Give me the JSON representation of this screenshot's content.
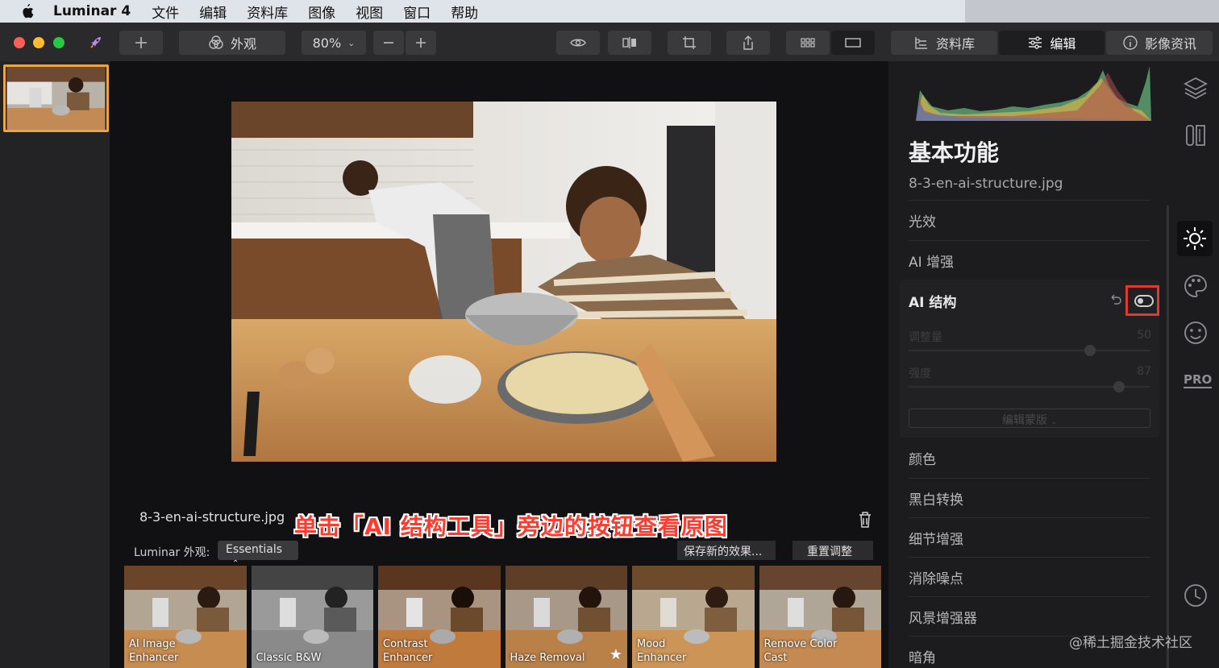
{
  "menubar": {
    "app_name": "Luminar 4",
    "items": [
      "文件",
      "编辑",
      "资料库",
      "图像",
      "视图",
      "窗口",
      "帮助"
    ]
  },
  "toolbar": {
    "looks_label": "外观",
    "zoom_value": "80%",
    "library_tab": "资料库",
    "edit_tab": "编辑",
    "info_tab": "影像资讯"
  },
  "canvas": {
    "filename": "8-3-en-ai-structure.jpg",
    "annotation": "单击「AI 结构工具」旁边的按钮查看原图"
  },
  "looks": {
    "label": "Luminar 外观:",
    "selected": "Essentials",
    "save_button": "保存新的效果...",
    "reset_button": "重置调整",
    "presets": [
      {
        "name": "AI Image Enhancer",
        "line1": "AI Image",
        "line2": "Enhancer"
      },
      {
        "name": "Classic B&W",
        "line1": "",
        "line2": "Classic B&W"
      },
      {
        "name": "Contrast Enhancer",
        "line1": "Contrast",
        "line2": "Enhancer"
      },
      {
        "name": "Haze Removal",
        "line1": "",
        "line2": "Haze Removal"
      },
      {
        "name": "Mood Enhancer",
        "line1": "Mood",
        "line2": "Enhancer"
      },
      {
        "name": "Remove Color Cast",
        "line1": "Remove Color",
        "line2": "Cast"
      }
    ]
  },
  "panel": {
    "title": "基本功能",
    "filename": "8-3-en-ai-structure.jpg",
    "sections_top": [
      "光效",
      "AI 增强"
    ],
    "ai_structure": {
      "title": "AI 结构",
      "amount_label": "调整量",
      "amount_value": "50",
      "amount_fraction": 0.75,
      "strength_label": "强度",
      "strength_value": "87",
      "strength_fraction": 0.87,
      "mask_button": "编辑蒙版"
    },
    "sections_bottom": [
      "颜色",
      "黑白转换",
      "细节增强",
      "消除噪点",
      "风景增强器",
      "暗角"
    ]
  },
  "rail": {
    "pro_label": "PRO"
  },
  "watermark": "@稀土掘金技术社区"
}
